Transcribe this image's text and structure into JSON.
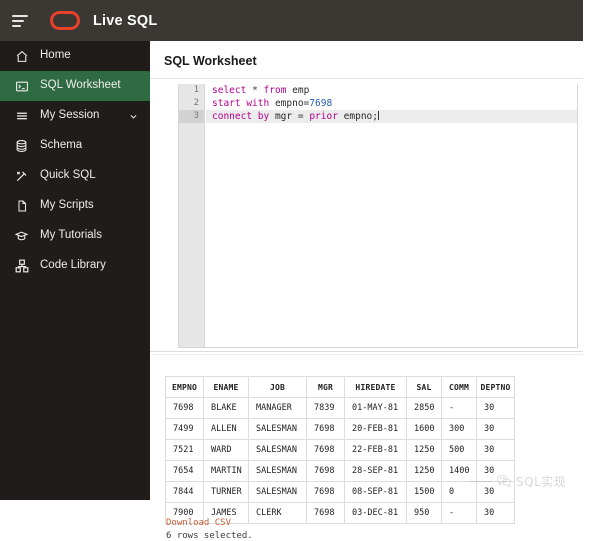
{
  "header": {
    "brand": "Live SQL",
    "menu_icon": "hamburger-icon",
    "logo_icon": "oracle-logo-icon"
  },
  "sidebar": {
    "items": [
      {
        "label": "Home",
        "icon": "home-icon",
        "active": false,
        "caret": false
      },
      {
        "label": "SQL Worksheet",
        "icon": "terminal-icon",
        "active": true,
        "caret": false
      },
      {
        "label": "My Session",
        "icon": "list-icon",
        "active": false,
        "caret": true
      },
      {
        "label": "Schema",
        "icon": "database-icon",
        "active": false,
        "caret": false
      },
      {
        "label": "Quick SQL",
        "icon": "wand-icon",
        "active": false,
        "caret": false
      },
      {
        "label": "My Scripts",
        "icon": "document-icon",
        "active": false,
        "caret": false
      },
      {
        "label": "My Tutorials",
        "icon": "graduation-icon",
        "active": false,
        "caret": false
      },
      {
        "label": "Code Library",
        "icon": "library-icon",
        "active": false,
        "caret": false
      }
    ]
  },
  "main": {
    "title": "SQL Worksheet"
  },
  "editor": {
    "active_line": 3,
    "lines": [
      {
        "number": "1",
        "text": "select * from emp"
      },
      {
        "number": "2",
        "text": "start with empno=7698"
      },
      {
        "number": "3",
        "text": "connect by mgr = prior empno;"
      }
    ]
  },
  "results": {
    "columns": [
      "EMPNO",
      "ENAME",
      "JOB",
      "MGR",
      "HIREDATE",
      "SAL",
      "COMM",
      "DEPTNO"
    ],
    "rows": [
      [
        "7698",
        "BLAKE",
        "MANAGER",
        "7839",
        "01-MAY-81",
        "2850",
        "-",
        "30"
      ],
      [
        "7499",
        "ALLEN",
        "SALESMAN",
        "7698",
        "20-FEB-81",
        "1600",
        "300",
        "30"
      ],
      [
        "7521",
        "WARD",
        "SALESMAN",
        "7698",
        "22-FEB-81",
        "1250",
        "500",
        "30"
      ],
      [
        "7654",
        "MARTIN",
        "SALESMAN",
        "7698",
        "28-SEP-81",
        "1250",
        "1400",
        "30"
      ],
      [
        "7844",
        "TURNER",
        "SALESMAN",
        "7698",
        "08-SEP-81",
        "1500",
        "0",
        "30"
      ],
      [
        "7900",
        "JAMES",
        "CLERK",
        "7698",
        "03-DEC-81",
        "950",
        "-",
        "30"
      ]
    ],
    "download_label": "Download CSV",
    "status": "6 rows selected."
  },
  "watermark": {
    "text": "SQL实现",
    "icon": "wechat-icon"
  },
  "colors": {
    "header_bg": "#3b3733",
    "sidebar_bg": "#201c1a",
    "sidebar_active": "#2f6b42",
    "oracle_red": "#e8412a",
    "keyword": "#b3008f",
    "number": "#2a5db0",
    "link": "#c8603a"
  }
}
